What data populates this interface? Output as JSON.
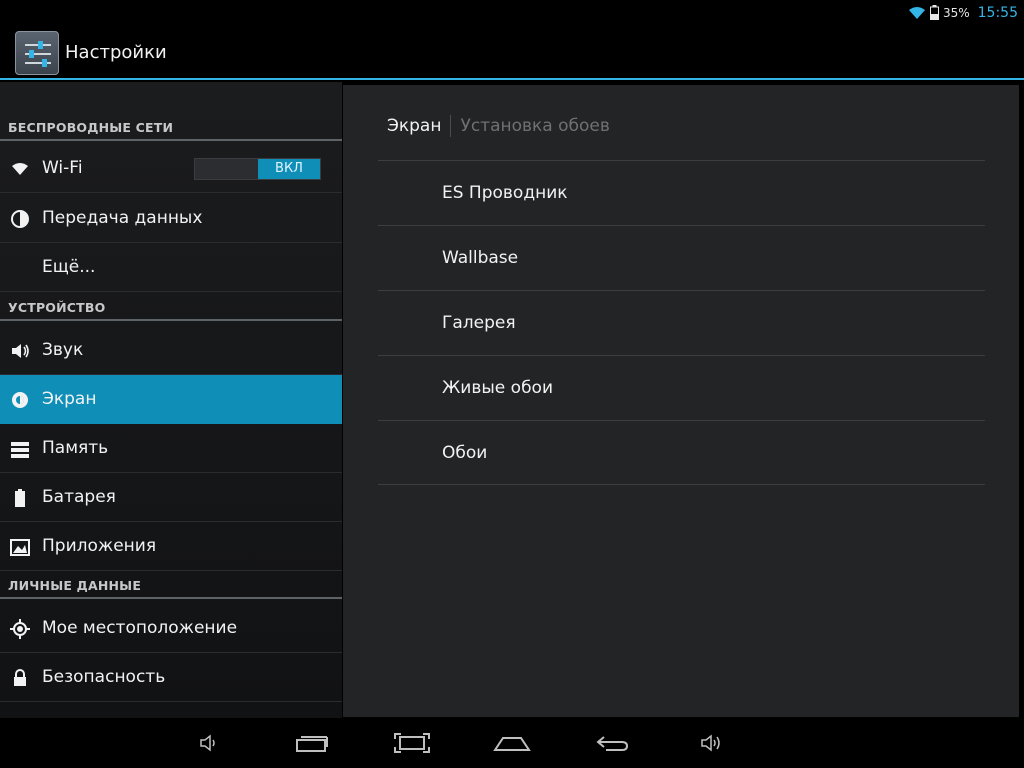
{
  "status_bar": {
    "battery_percent": "35%",
    "time": "15:55"
  },
  "action_bar": {
    "title": "Настройки",
    "icon": "settings-sliders-icon"
  },
  "sidebar": {
    "sections": [
      {
        "header": "БЕСПРОВОДНЫЕ СЕТИ"
      },
      {
        "header": "УСТРОЙСТВО"
      },
      {
        "header": "ЛИЧНЫЕ ДАННЫЕ"
      }
    ],
    "items": [
      {
        "label": "Wi-Fi",
        "icon": "wifi-icon",
        "toggle": "ВКЛ"
      },
      {
        "label": "Передача данных",
        "icon": "data-usage-icon"
      },
      {
        "label": "Ещё...",
        "icon": ""
      },
      {
        "label": "Звук",
        "icon": "speaker-icon"
      },
      {
        "label": "Экран",
        "icon": "brightness-icon",
        "selected": true
      },
      {
        "label": "Память",
        "icon": "storage-icon"
      },
      {
        "label": "Батарея",
        "icon": "battery-icon"
      },
      {
        "label": "Приложения",
        "icon": "apps-icon"
      },
      {
        "label": "Мое местоположение",
        "icon": "location-icon"
      },
      {
        "label": "Безопасность",
        "icon": "lock-icon"
      }
    ]
  },
  "panel": {
    "breadcrumb_current": "Экран",
    "breadcrumb_next": "Установка обоев",
    "options": [
      "ES Проводник",
      "Wallbase",
      "Галерея",
      "Живые обои",
      "Обои"
    ]
  },
  "navbar": {
    "buttons": [
      "volume-down-icon",
      "recent-apps-icon",
      "screenshot-icon",
      "home-icon",
      "back-icon",
      "volume-up-icon"
    ]
  },
  "colors": {
    "accent": "#33b5e5",
    "selected": "#0f8fb8"
  }
}
